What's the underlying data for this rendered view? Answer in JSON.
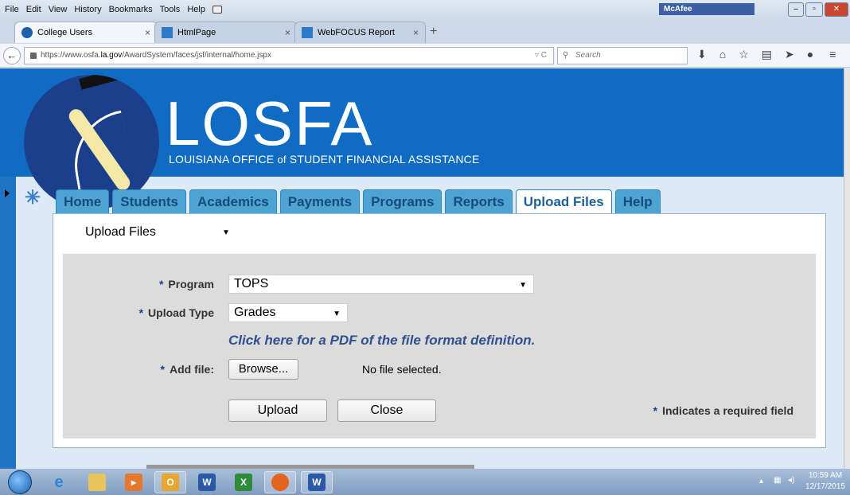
{
  "browser": {
    "menu": [
      "File",
      "Edit",
      "View",
      "History",
      "Bookmarks",
      "Tools",
      "Help"
    ],
    "mcafee": "McAfee",
    "tabs": [
      {
        "title": "College Users",
        "active": true
      },
      {
        "title": "HtmlPage",
        "active": false
      },
      {
        "title": "WebFOCUS Report",
        "active": false
      }
    ],
    "url_prefix": "https://www.osfa.",
    "url_domain": "la.gov",
    "url_path": "/AwardSystem/faces/jsf/internal/home.jspx",
    "search_placeholder": "Search"
  },
  "banner": {
    "logo": "LOSFA",
    "subtitle_a": "LOUISIANA OFFICE ",
    "subtitle_of": "of",
    "subtitle_b": " STUDENT FINANCIAL ASSISTANCE"
  },
  "nav": {
    "tabs": [
      "Home",
      "Students",
      "Academics",
      "Payments",
      "Programs",
      "Reports",
      "Upload Files",
      "Help"
    ],
    "active": "Upload Files"
  },
  "panel": {
    "section_select": "Upload Files",
    "program_label": "Program",
    "program_value": "TOPS",
    "upload_type_label": "Upload Type",
    "upload_type_value": "Grades",
    "pdf_link": "Click here for a PDF of the file format definition.",
    "add_file_label": "Add file:",
    "browse": "Browse...",
    "no_file": "No file selected.",
    "upload": "Upload",
    "close": "Close",
    "required_note": "Indicates a required field",
    "star": "*"
  },
  "taskbar": {
    "time": "10:59 AM",
    "date": "12/17/2015"
  }
}
